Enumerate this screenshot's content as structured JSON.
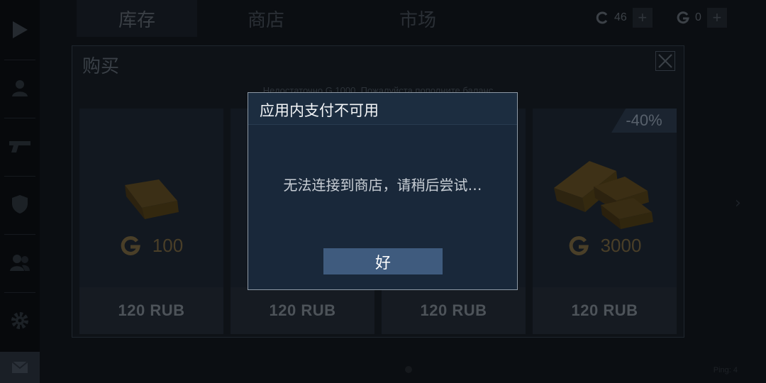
{
  "top_tabs": [
    {
      "label": "库存",
      "active": true
    },
    {
      "label": "商店",
      "active": false
    },
    {
      "label": "市场",
      "active": false
    }
  ],
  "currencies": [
    {
      "icon": "c-coin-icon",
      "value": "46"
    },
    {
      "icon": "g-coin-icon",
      "value": "0"
    }
  ],
  "sidebar_icons": [
    "play-icon",
    "profile-icon",
    "gun-icon",
    "shield-icon",
    "friends-icon",
    "gear-icon",
    "mail-icon"
  ],
  "purchase_panel": {
    "title": "购买",
    "notice": "Недостаточно G 1000. Пожалуйста пополните баланс",
    "cards": [
      {
        "amount": "100",
        "price": "120 RUB",
        "discount": ""
      },
      {
        "amount": "",
        "price": "120 RUB",
        "discount": ""
      },
      {
        "amount": "",
        "price": "120 RUB",
        "discount": ""
      },
      {
        "amount": "3000",
        "price": "120 RUB",
        "discount": "-40%"
      }
    ]
  },
  "dialog": {
    "title": "应用内支付不可用",
    "message": "无法连接到商店，请稍后尝试…",
    "ok_label": "好"
  },
  "bottom_right_text": "Ping: 4",
  "colors": {
    "dialog_bg": "#19283a",
    "dialog_border": "#8e99a5",
    "button": "#3f5b7e",
    "gold": "#4a3f28"
  }
}
